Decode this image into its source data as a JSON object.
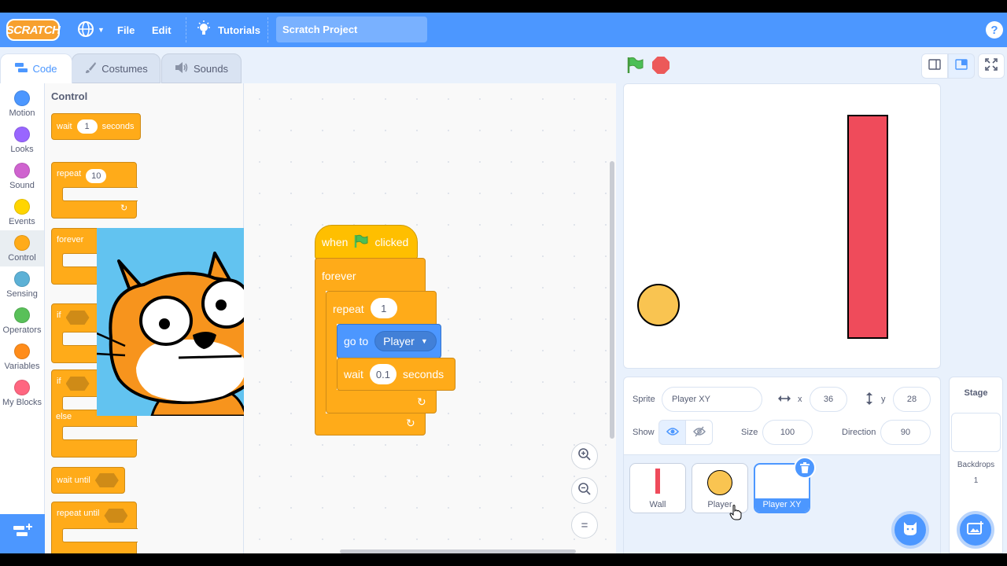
{
  "menubar": {
    "logo": "SCRATCH",
    "file": "File",
    "edit": "Edit",
    "tutorials": "Tutorials",
    "project_title": "Scratch Project",
    "help": "?"
  },
  "tabs": {
    "code": "Code",
    "costumes": "Costumes",
    "sounds": "Sounds"
  },
  "categories": [
    {
      "label": "Motion",
      "color": "#4c97ff"
    },
    {
      "label": "Looks",
      "color": "#9966ff"
    },
    {
      "label": "Sound",
      "color": "#cf63cf"
    },
    {
      "label": "Events",
      "color": "#ffd500"
    },
    {
      "label": "Control",
      "color": "#ffab19"
    },
    {
      "label": "Sensing",
      "color": "#5cb1d6"
    },
    {
      "label": "Operators",
      "color": "#59c059"
    },
    {
      "label": "Variables",
      "color": "#ff8c1a"
    },
    {
      "label": "My Blocks",
      "color": "#ff6680"
    }
  ],
  "palette": {
    "heading": "Control",
    "wait": "wait",
    "wait_value": "1",
    "seconds": "seconds",
    "repeat": "repeat",
    "repeat_value": "10",
    "forever": "forever",
    "if": "if",
    "if2": "if",
    "else": "else",
    "wait_until": "wait until",
    "repeat_until": "repeat until"
  },
  "script": {
    "when": "when",
    "clicked": "clicked",
    "forever": "forever",
    "repeat": "repeat",
    "repeat_value": "1",
    "go_to": "go to",
    "go_to_target": "Player",
    "wait": "wait",
    "wait_value": "0.1",
    "seconds": "seconds"
  },
  "zoom": {
    "in": "+",
    "out": "−",
    "reset": "="
  },
  "sprite_info": {
    "sprite_label": "Sprite",
    "sprite_name": "Player XY",
    "x_label": "x",
    "x_value": "36",
    "y_label": "y",
    "y_value": "28",
    "show_label": "Show",
    "size_label": "Size",
    "size_value": "100",
    "direction_label": "Direction",
    "direction_value": "90"
  },
  "sprites": [
    {
      "name": "Wall"
    },
    {
      "name": "Player"
    },
    {
      "name": "Player XY"
    }
  ],
  "stage_panel": {
    "title": "Stage",
    "backdrops_label": "Backdrops",
    "backdrops_count": "1"
  },
  "colors": {
    "brand_blue": "#4c97ff",
    "control_orange": "#ffab19",
    "wall_red": "#ef4b5b",
    "player_yellow": "#f9c451"
  }
}
